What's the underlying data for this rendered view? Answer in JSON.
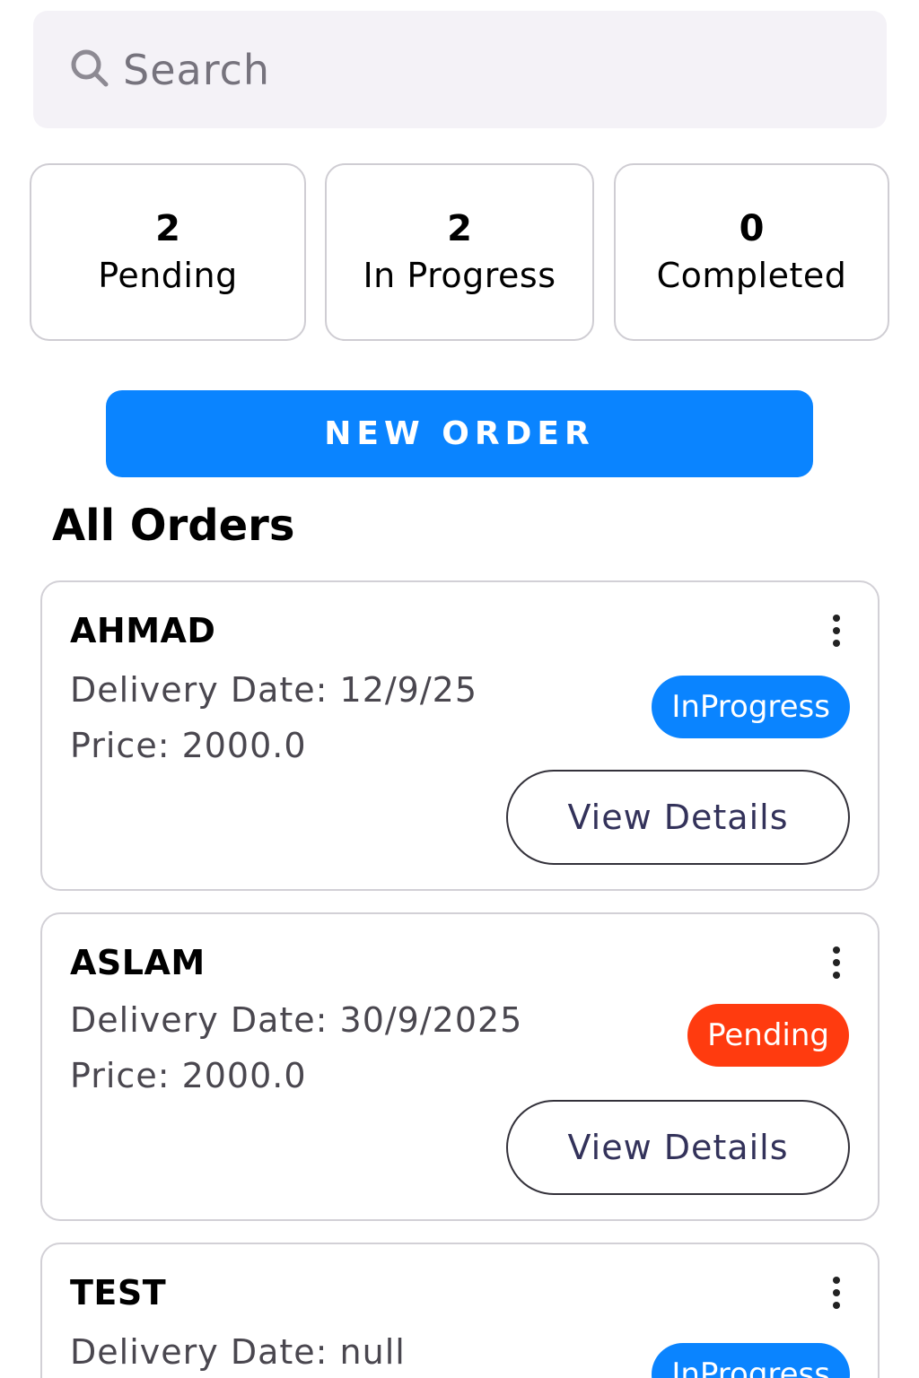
{
  "search": {
    "placeholder": "Search"
  },
  "stats": [
    {
      "count": "2",
      "label": "Pending"
    },
    {
      "count": "2",
      "label": "In Progress"
    },
    {
      "count": "0",
      "label": "Completed"
    }
  ],
  "new_order_label": "NEW ORDER",
  "section_title": "All Orders",
  "orders": [
    {
      "name": "AHMAD",
      "delivery": "Delivery Date: 12/9/25",
      "price": "Price: 2000.0",
      "status": "InProgress",
      "action": "View Details"
    },
    {
      "name": "ASLAM",
      "delivery": "Delivery Date: 30/9/2025",
      "price": "Price: 2000.0",
      "status": "Pending",
      "action": "View Details"
    },
    {
      "name": "TEST",
      "delivery": "Delivery Date: null",
      "status": "InProgress"
    }
  ],
  "colors": {
    "accent": "#0a84ff",
    "pending": "#ff3b0f",
    "search_bg": "#f4f2f7"
  },
  "icons": {
    "search": "search-icon",
    "more": "more-vertical-icon"
  }
}
